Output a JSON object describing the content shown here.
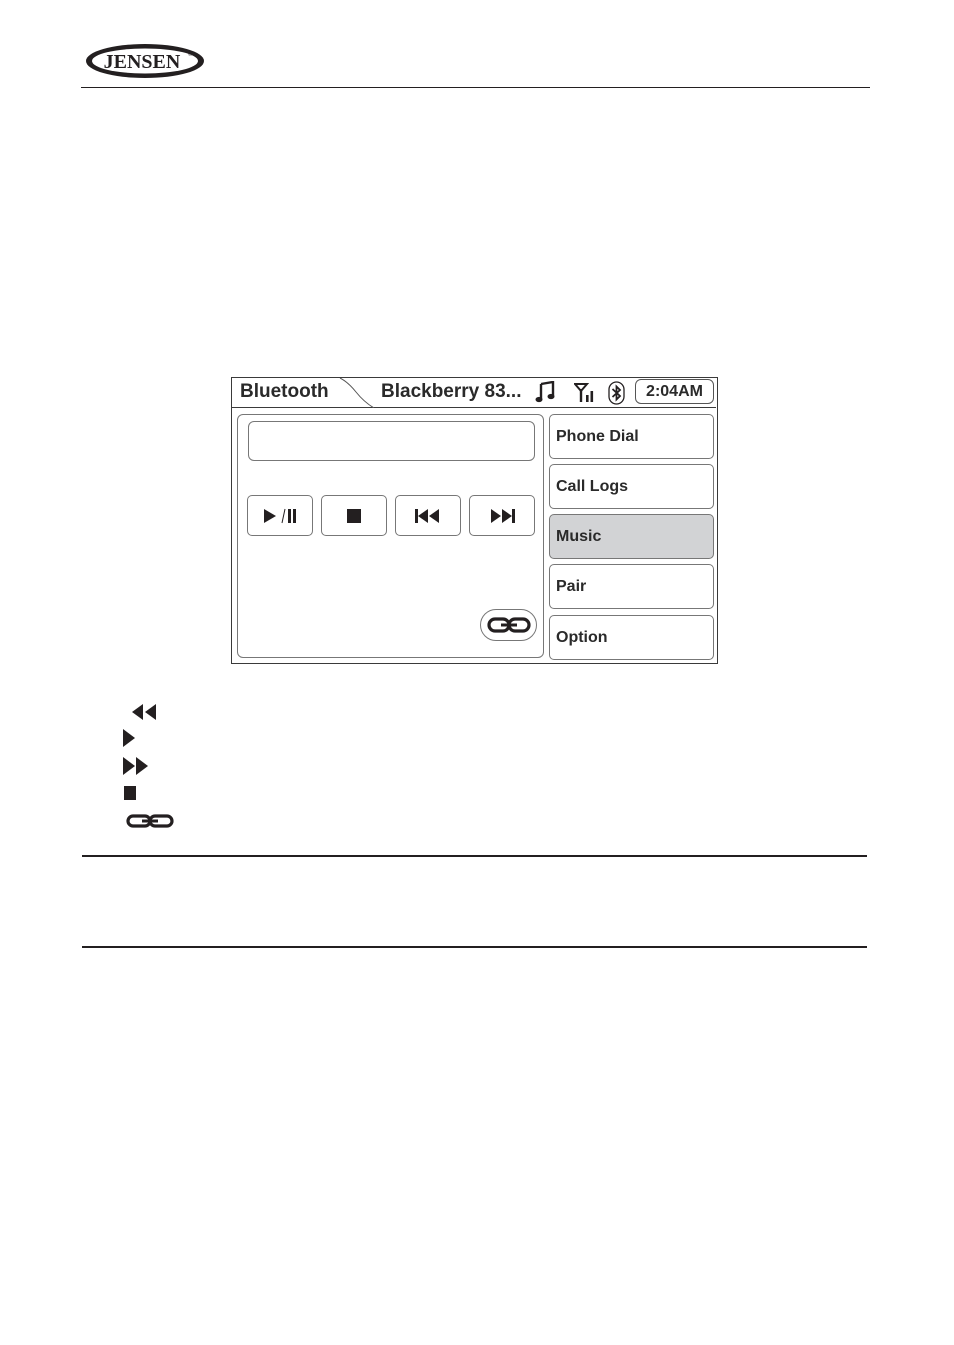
{
  "brand": {
    "logo_text": "JENSEN",
    "registered_mark": "®"
  },
  "screen": {
    "status_bar": {
      "tab_title": "Bluetooth",
      "device_name": "Blackberry 83...",
      "icons": [
        "music-note-icon",
        "signal-strength-icon",
        "bluetooth-icon"
      ],
      "clock": "2:04AM"
    },
    "music_panel": {
      "track_display": "",
      "controls": [
        {
          "name": "play-pause",
          "icon": "play-pause-icon"
        },
        {
          "name": "stop",
          "icon": "stop-icon"
        },
        {
          "name": "previous",
          "icon": "skip-back-icon"
        },
        {
          "name": "next",
          "icon": "skip-forward-icon"
        }
      ],
      "link_button_icon": "link-icon"
    },
    "menu": {
      "items": [
        {
          "label": "Phone Dial",
          "active": false
        },
        {
          "label": "Call Logs",
          "active": false
        },
        {
          "label": "Music",
          "active": true
        },
        {
          "label": "Pair",
          "active": false
        },
        {
          "label": "Option",
          "active": false
        }
      ]
    }
  },
  "legend": {
    "icons": [
      "rewind-icon",
      "play-icon",
      "fast-forward-icon",
      "stop-icon",
      "link-icon"
    ]
  },
  "colors": {
    "text": "#231f20",
    "active_menu": "#d2d3d5",
    "border": "#777777"
  }
}
